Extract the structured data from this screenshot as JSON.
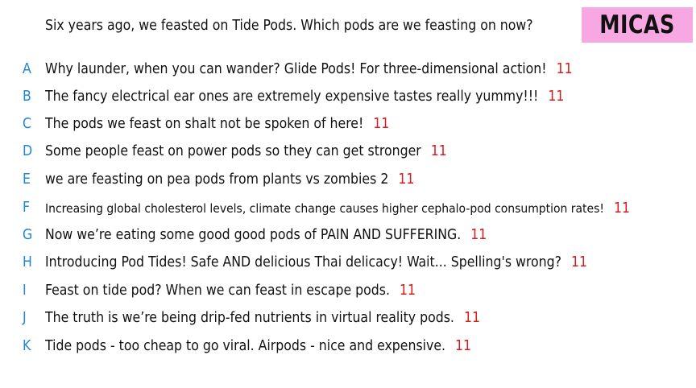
{
  "question": "Six years ago, we feasted on Tide Pods. Which pods are we feasting on now?",
  "logo": "MICAS",
  "colors": {
    "letter": "#1f86d6",
    "count": "#d81b1b",
    "logo_bg": "#f7a8e3"
  },
  "answers": [
    {
      "letter": "A",
      "text": "Why launder, when you can wander? Glide Pods! For three-dimensional action!",
      "count": "11"
    },
    {
      "letter": "B",
      "text": "The fancy electrical ear ones are extremely expensive tastes really yummy!!!",
      "count": "11"
    },
    {
      "letter": "C",
      "text": "The pods we feast on shalt not be spoken of here!",
      "count": "11"
    },
    {
      "letter": "D",
      "text": "Some people feast on power pods so they can get stronger",
      "count": "11"
    },
    {
      "letter": "E",
      "text": "we are feasting on pea pods from plants vs zombies 2",
      "count": "11"
    },
    {
      "letter": "F",
      "text": "Increasing global cholesterol levels, climate change causes higher cephalo-pod consumption rates!",
      "count": "11"
    },
    {
      "letter": "G",
      "text": "Now we’re eating some good good pods of PAIN AND SUFFERING.",
      "count": "11"
    },
    {
      "letter": "H",
      "text": "Introducing Pod Tides! Safe AND delicious Thai delicacy! Wait... Spelling's wrong?",
      "count": "11"
    },
    {
      "letter": "I",
      "text": "Feast on tide pod? When we can feast in escape pods.",
      "count": "11"
    },
    {
      "letter": "J",
      "text": "The truth is we’re being drip-fed nutrients in virtual reality pods.",
      "count": "11"
    },
    {
      "letter": "K",
      "text": "Tide pods - too cheap to go viral. Airpods - nice and expensive.",
      "count": "11"
    }
  ]
}
